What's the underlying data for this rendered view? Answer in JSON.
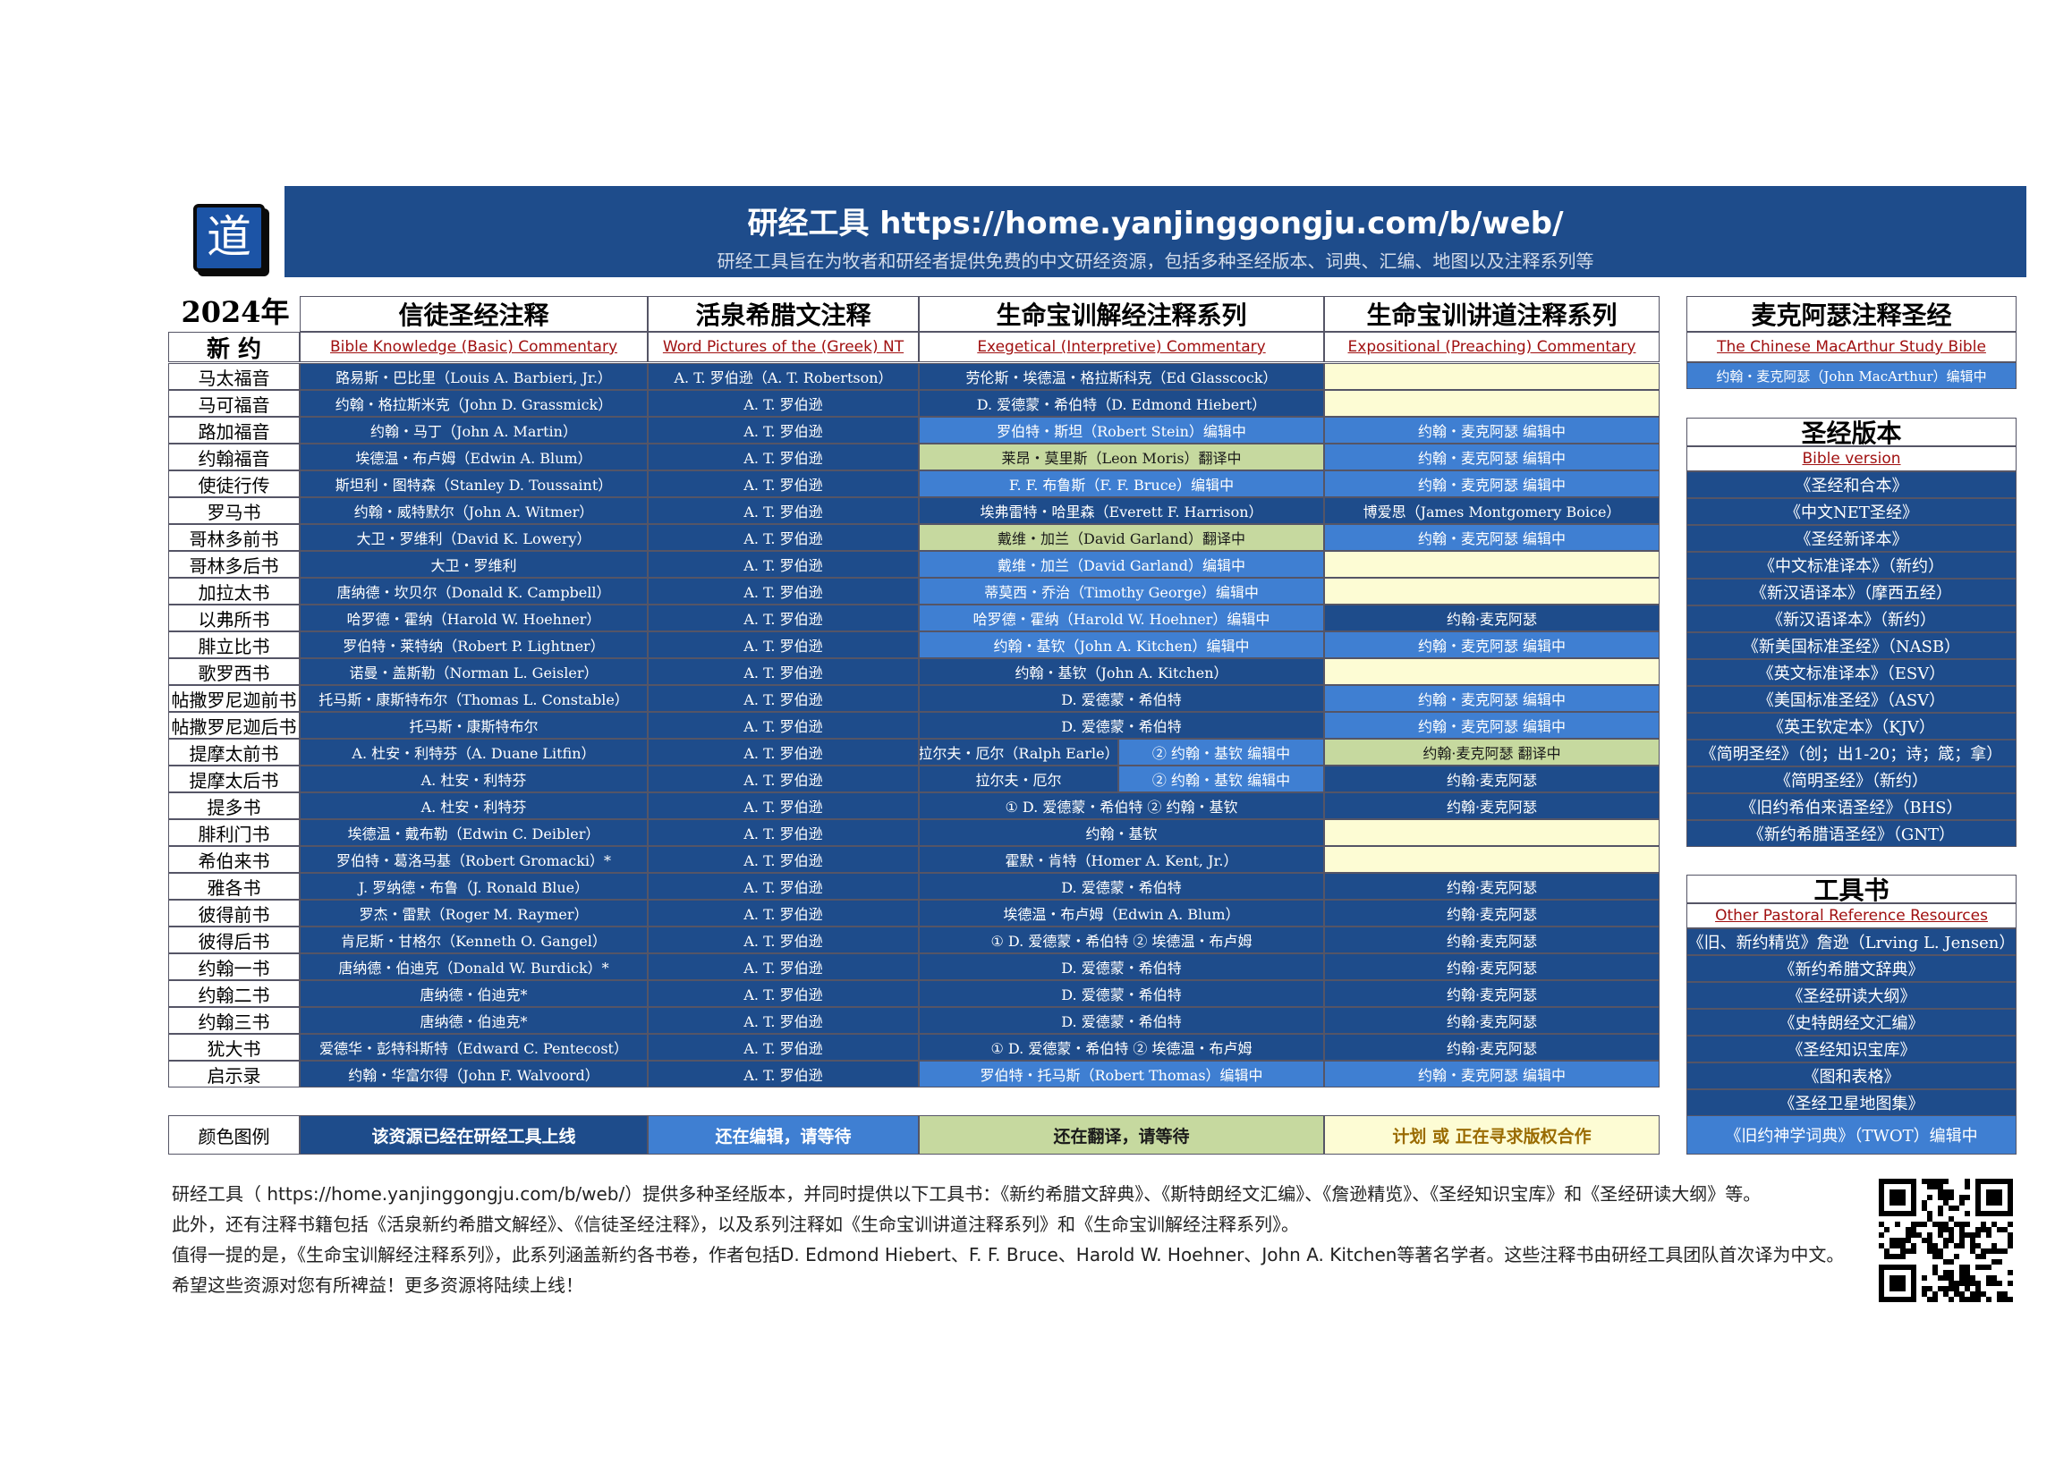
{
  "header": {
    "logo_char": "道",
    "title": "研经工具   https://home.yanjinggongju.com/b/web/",
    "subtitle": "研经工具旨在为牧者和研经者提供免费的中文研经资源，包括多种圣经版本、词典、汇编、地图以及注释系列等"
  },
  "year": "2024年",
  "main_table": {
    "section": "新 约",
    "headers": [
      "信徒圣经注释",
      "活泉希腊文注释",
      "生命宝训解经注释系列",
      "生命宝训讲道注释系列"
    ],
    "subheaders": [
      "Bible Knowledge (Basic) Commentary",
      "Word Pictures of the (Greek) NT",
      "Exegetical (Interpretive) Commentary",
      "Expositional (Preaching) Commentary"
    ],
    "books": [
      "马太福音",
      "马可福音",
      "路加福音",
      "约翰福音",
      "使徒行传",
      "罗马书",
      "哥林多前书",
      "哥林多后书",
      "加拉太书",
      "以弗所书",
      "腓立比书",
      "歌罗西书",
      "帖撒罗尼迦前书",
      "帖撒罗尼迦后书",
      "提摩太前书",
      "提摩太后书",
      "提多书",
      "腓利门书",
      "希伯来书",
      "雅各书",
      "彼得前书",
      "彼得后书",
      "约翰一书",
      "约翰二书",
      "约翰三书",
      "犹大书",
      "启示录"
    ],
    "col1": [
      "路易斯・巴比里（Louis A. Barbieri, Jr.）",
      "约翰・格拉斯米克（John D. Grassmick）",
      "约翰・马丁（John A. Martin）",
      "埃德温・布卢姆（Edwin A. Blum）",
      "斯坦利・图特森（Stanley D. Toussaint）",
      "约翰・威特默尔（John A. Witmer）",
      "大卫・罗维利（David K. Lowery）",
      "大卫・罗维利",
      "唐纳德・坎贝尔（Donald K. Campbell）",
      "哈罗德・霍纳（Harold W. Hoehner）",
      "罗伯特・莱特纳（Robert P. Lightner）",
      "诺曼・盖斯勒（Norman L. Geisler）",
      "托马斯・康斯特布尔（Thomas L. Constable）",
      "托马斯・康斯特布尔",
      "A. 杜安・利特芬（A. Duane Litfin）",
      "A. 杜安・利特芬",
      "A. 杜安・利特芬",
      "埃德温・戴布勒（Edwin C. Deibler）",
      "罗伯特・葛洛马基（Robert Gromacki）*",
      "J. 罗纳德・布鲁（J. Ronald Blue）",
      "罗杰・雷默（Roger M. Raymer）",
      "肯尼斯・甘格尔（Kenneth O. Gangel）",
      "唐纳德・伯迪克（Donald W. Burdick）*",
      "唐纳德・伯迪克*",
      "唐纳德・伯迪克*",
      "爱德华・彭特科斯特（Edward C. Pentecost）",
      "约翰・华富尔得（John F. Walvoord）"
    ],
    "col2_first": "A. T. 罗伯逊（A. T. Robertson）",
    "col2_rest": "A. T. 罗伯逊",
    "col3": [
      {
        "t": "劳伦斯・埃德温・格拉斯科克（Ed Glasscock）",
        "s": "d"
      },
      {
        "t": "D. 爱德蒙・希伯特（D. Edmond Hiebert）",
        "s": "d"
      },
      {
        "t": "罗伯特・斯坦（Robert Stein）编辑中",
        "s": "m"
      },
      {
        "t": "莱昂・莫里斯（Leon Moris）翻译中",
        "s": "g"
      },
      {
        "t": "F. F. 布鲁斯（F. F. Bruce）编辑中",
        "s": "m"
      },
      {
        "t": "埃弗雷特・哈里森（Everett F. Harrison）",
        "s": "d"
      },
      {
        "t": "戴维・加兰（David Garland）翻译中",
        "s": "g"
      },
      {
        "t": "戴维・加兰（David Garland）编辑中",
        "s": "m"
      },
      {
        "t": "蒂莫西・乔治（Timothy George）编辑中",
        "s": "m"
      },
      {
        "t": "哈罗德・霍纳（Harold W. Hoehner）编辑中",
        "s": "m"
      },
      {
        "t": "约翰・基钦（John A. Kitchen）编辑中",
        "s": "m"
      },
      {
        "t": "约翰・基钦（John A. Kitchen）",
        "s": "d"
      },
      {
        "t": "D. 爱德蒙・希伯特",
        "s": "d"
      },
      {
        "t": "D. 爱德蒙・希伯特",
        "s": "d"
      },
      {
        "t": "拉尔夫・厄尔（Ralph Earle）",
        "s": "d",
        "t2": "② 约翰・基钦 编辑中",
        "s2": "m"
      },
      {
        "t": "拉尔夫・厄尔",
        "s": "d",
        "t2": "② 约翰・基钦 编辑中",
        "s2": "m"
      },
      {
        "t": "① D. 爱德蒙・希伯特  ② 约翰・基钦",
        "s": "d"
      },
      {
        "t": "约翰・基钦",
        "s": "d"
      },
      {
        "t": "霍默・肯特（Homer A. Kent, Jr.）",
        "s": "d"
      },
      {
        "t": "D. 爱德蒙・希伯特",
        "s": "d"
      },
      {
        "t": "埃德温・布卢姆（Edwin A. Blum）",
        "s": "d"
      },
      {
        "t": "① D. 爱德蒙・希伯特 ② 埃德温・布卢姆",
        "s": "d"
      },
      {
        "t": "D. 爱德蒙・希伯特",
        "s": "d"
      },
      {
        "t": "D. 爱德蒙・希伯特",
        "s": "d"
      },
      {
        "t": "D. 爱德蒙・希伯特",
        "s": "d"
      },
      {
        "t": "① D. 爱德蒙・希伯特 ② 埃德温・布卢姆",
        "s": "d"
      },
      {
        "t": "罗伯特・托马斯（Robert Thomas）编辑中",
        "s": "m"
      }
    ],
    "col4": [
      {
        "t": "",
        "s": "y"
      },
      {
        "t": "",
        "s": "y"
      },
      {
        "t": "约翰・麦克阿瑟 编辑中",
        "s": "m"
      },
      {
        "t": "约翰・麦克阿瑟 编辑中",
        "s": "m"
      },
      {
        "t": "约翰・麦克阿瑟 编辑中",
        "s": "m"
      },
      {
        "t": "博爱思（James Montgomery Boice）",
        "s": "d"
      },
      {
        "t": "约翰・麦克阿瑟 编辑中",
        "s": "m"
      },
      {
        "t": "",
        "s": "y"
      },
      {
        "t": "",
        "s": "y"
      },
      {
        "t": "约翰·麦克阿瑟",
        "s": "d"
      },
      {
        "t": "约翰・麦克阿瑟 编辑中",
        "s": "m"
      },
      {
        "t": "",
        "s": "y"
      },
      {
        "t": "约翰・麦克阿瑟 编辑中",
        "s": "m"
      },
      {
        "t": "约翰・麦克阿瑟 编辑中",
        "s": "m"
      },
      {
        "t": "约翰·麦克阿瑟 翻译中",
        "s": "g"
      },
      {
        "t": "约翰·麦克阿瑟",
        "s": "d"
      },
      {
        "t": "约翰·麦克阿瑟",
        "s": "d"
      },
      {
        "t": "",
        "s": "y"
      },
      {
        "t": "",
        "s": "y"
      },
      {
        "t": "约翰·麦克阿瑟",
        "s": "d"
      },
      {
        "t": "约翰·麦克阿瑟",
        "s": "d"
      },
      {
        "t": "约翰·麦克阿瑟",
        "s": "d"
      },
      {
        "t": "约翰·麦克阿瑟",
        "s": "d"
      },
      {
        "t": "约翰·麦克阿瑟",
        "s": "d"
      },
      {
        "t": "约翰·麦克阿瑟",
        "s": "d"
      },
      {
        "t": "约翰·麦克阿瑟",
        "s": "d"
      },
      {
        "t": "约翰・麦克阿瑟 编辑中",
        "s": "m"
      }
    ]
  },
  "macarthur": {
    "title": "麦克阿瑟注释圣经",
    "subtitle": "The Chinese MacArthur Study Bible",
    "item": "约翰・麦克阿瑟（John MacArthur）编辑中"
  },
  "versions": {
    "title": "圣经版本",
    "subtitle": "Bible version",
    "items": [
      "《圣经和合本》",
      "《中文NET圣经》",
      "《圣经新译本》",
      "《中文标准译本》（新约）",
      "《新汉语译本》（摩西五经）",
      "《新汉语译本》（新约）",
      "《新美国标准圣经》（NASB）",
      "《英文标准译本》（ESV）",
      "《美国标准圣经》（ASV）",
      "《英王钦定本》（KJV）",
      "《简明圣经》（创；出1-20；诗；箴；拿）",
      "《简明圣经》（新约）",
      "《旧约希伯来语圣经》（BHS）",
      "《新约希腊语圣经》（GNT）"
    ]
  },
  "tools": {
    "title": "工具书",
    "subtitle": "Other Pastoral Reference Resources",
    "items": [
      "《旧、新约精览》詹逊（Lrving L. Jensen）",
      "《新约希腊文辞典》",
      "《圣经研读大纲》",
      "《史特朗经文汇编》",
      "《圣经知识宝库》",
      "《图和表格》",
      "《圣经卫星地图集》"
    ],
    "twot": "《旧约神学词典》（TWOT）编辑中"
  },
  "legend": {
    "label": "颜色图例",
    "online": "该资源已经在研经工具上线",
    "editing": "还在编辑，请等待",
    "translating": "还在翻译，请等待",
    "planned": "计划 或 正在寻求版权合作"
  },
  "footer": {
    "lines": [
      "研经工具（ https://home.yanjinggongju.com/b/web/）提供多种圣经版本，并同时提供以下工具书：《新约希腊文辞典》、《斯特朗经文汇编》、《詹逊精览》、《圣经知识宝库》和《圣经研读大纲》等。",
      "此外，还有注释书籍包括《活泉新约希腊文解经》、《信徒圣经注释》，以及系列注释如《生命宝训讲道注释系列》和《生命宝训解经注释系列》。",
      " 值得一提的是，《生命宝训解经注释系列》，此系列涵盖新约各书卷，作者包括D. Edmond Hiebert、F. F. Bruce、Harold W. Hoehner、John A. Kitchen等著名学者。这些注释书由研经工具团队首次译为中文。",
      "希望这些资源对您有所裨益！更多资源将陆续上线！"
    ]
  },
  "colors": {
    "online": "#1e4c8b",
    "editing": "#3f7fd2",
    "translating": "#c6d99f",
    "planned": "#fdfcd4"
  },
  "qr": "qr-code-icon"
}
